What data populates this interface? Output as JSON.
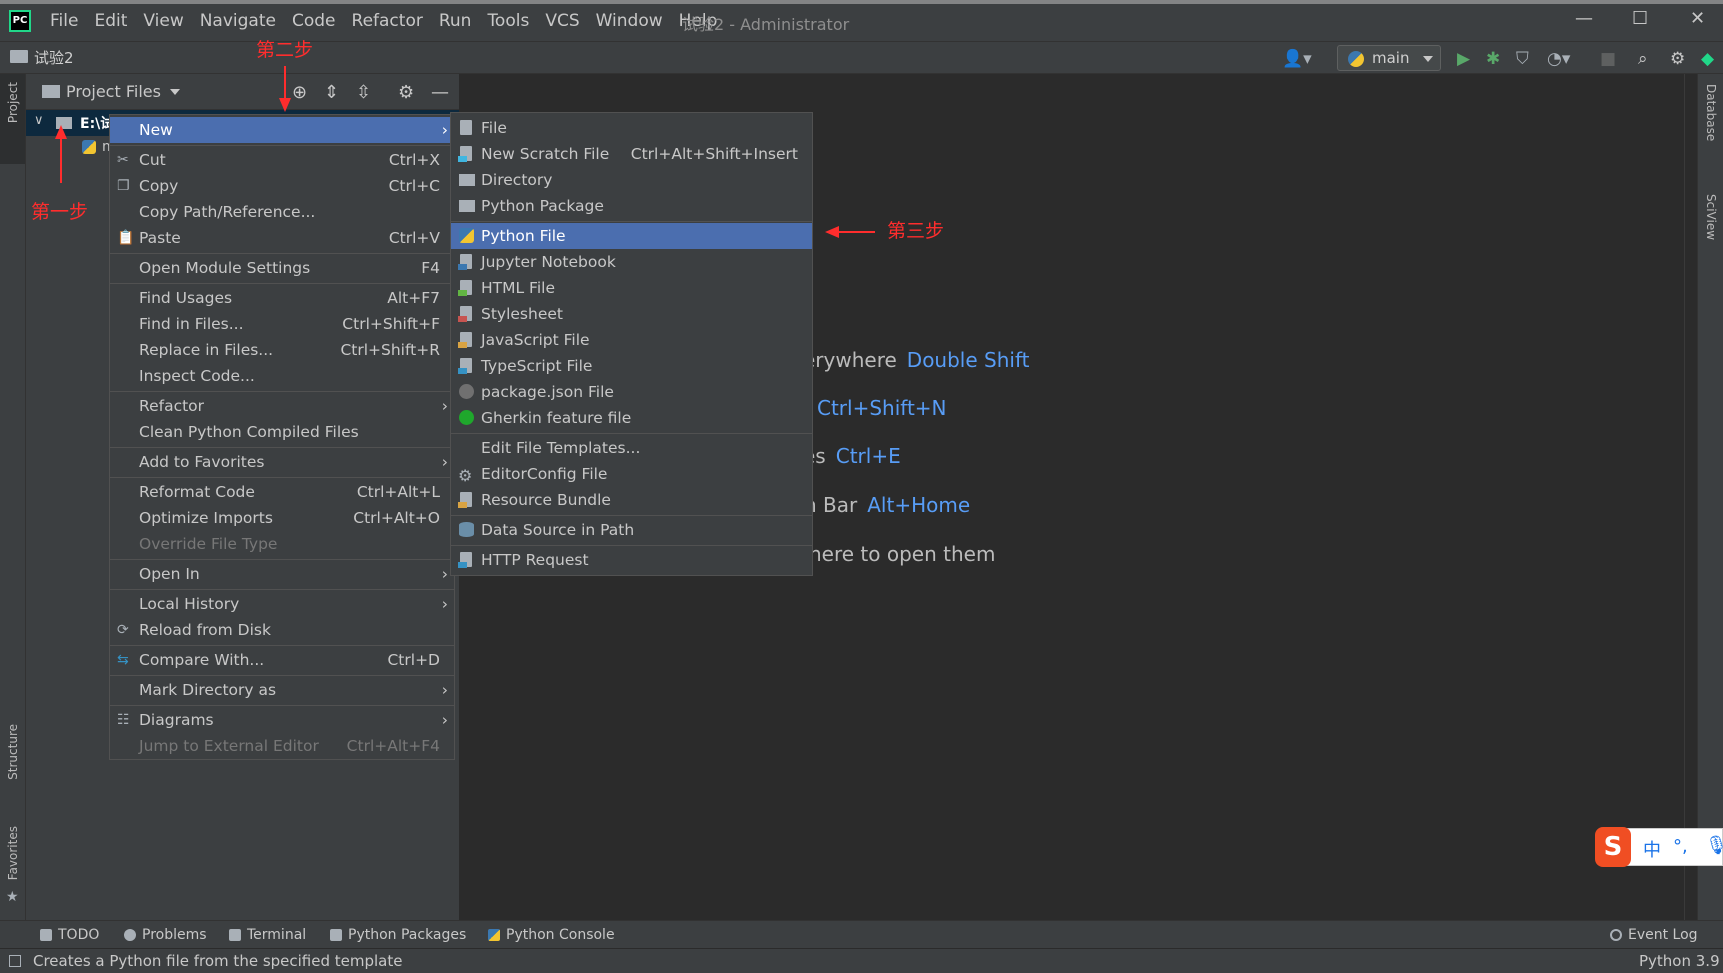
{
  "menubar": [
    "File",
    "Edit",
    "View",
    "Navigate",
    "Code",
    "Refactor",
    "Run",
    "Tools",
    "VCS",
    "Window",
    "Help"
  ],
  "window_title": "试验2 - Administrator",
  "window_controls": {
    "minimize": "—",
    "maximize": "☐",
    "close": "✕"
  },
  "logo": "PC",
  "breadcrumb": "试验2",
  "run_config": "main",
  "left_strip": {
    "top": "Project",
    "structure": "Structure",
    "favorites": "Favorites"
  },
  "right_strip": {
    "database": "Database",
    "sciview": "SciView"
  },
  "project_panel": {
    "title": "Project Files",
    "tree_root": "E:\\试",
    "tree_child": "m"
  },
  "editor_hints": [
    {
      "text": "erywhere",
      "key": "Double Shift"
    },
    {
      "text": "",
      "key": "Ctrl+Shift+N"
    },
    {
      "text": "es",
      "key": "Ctrl+E"
    },
    {
      "text": "n Bar",
      "key": "Alt+Home"
    },
    {
      "text": "here to open them",
      "key": ""
    }
  ],
  "context_menu": [
    {
      "label": "New",
      "shortcut": "",
      "submenu": true,
      "selected": true
    },
    {
      "label": "Cut",
      "shortcut": "Ctrl+X",
      "icon": "scissors-icon"
    },
    {
      "label": "Copy",
      "shortcut": "Ctrl+C",
      "icon": "copy-icon"
    },
    {
      "label": "Copy Path/Reference...",
      "shortcut": ""
    },
    {
      "label": "Paste",
      "shortcut": "Ctrl+V",
      "icon": "paste-icon"
    },
    {
      "label": "Open Module Settings",
      "shortcut": "F4"
    },
    {
      "label": "Find Usages",
      "shortcut": "Alt+F7"
    },
    {
      "label": "Find in Files...",
      "shortcut": "Ctrl+Shift+F"
    },
    {
      "label": "Replace in Files...",
      "shortcut": "Ctrl+Shift+R"
    },
    {
      "label": "Inspect Code...",
      "shortcut": ""
    },
    {
      "label": "Refactor",
      "shortcut": "",
      "submenu": true
    },
    {
      "label": "Clean Python Compiled Files",
      "shortcut": ""
    },
    {
      "label": "Add to Favorites",
      "shortcut": "",
      "submenu": true
    },
    {
      "label": "Reformat Code",
      "shortcut": "Ctrl+Alt+L"
    },
    {
      "label": "Optimize Imports",
      "shortcut": "Ctrl+Alt+O"
    },
    {
      "label": "Override File Type",
      "shortcut": "",
      "disabled": true
    },
    {
      "label": "Open In",
      "shortcut": "",
      "submenu": true
    },
    {
      "label": "Local History",
      "shortcut": "",
      "submenu": true
    },
    {
      "label": "Reload from Disk",
      "shortcut": "",
      "icon": "reload-icon"
    },
    {
      "label": "Compare With...",
      "shortcut": "Ctrl+D",
      "icon": "compare-icon"
    },
    {
      "label": "Mark Directory as",
      "shortcut": "",
      "submenu": true
    },
    {
      "label": "Diagrams",
      "shortcut": "",
      "submenu": true,
      "icon": "diagram-icon"
    },
    {
      "label": "Jump to External Editor",
      "shortcut": "Ctrl+Alt+F4",
      "disabled": true
    }
  ],
  "submenu": [
    {
      "label": "File",
      "shortcut": ""
    },
    {
      "label": "New Scratch File",
      "shortcut": "Ctrl+Alt+Shift+Insert"
    },
    {
      "label": "Directory",
      "shortcut": ""
    },
    {
      "label": "Python Package",
      "shortcut": ""
    },
    {
      "label": "Python File",
      "shortcut": "",
      "selected": true
    },
    {
      "label": "Jupyter Notebook",
      "shortcut": ""
    },
    {
      "label": "HTML File",
      "shortcut": ""
    },
    {
      "label": "Stylesheet",
      "shortcut": ""
    },
    {
      "label": "JavaScript File",
      "shortcut": ""
    },
    {
      "label": "TypeScript File",
      "shortcut": ""
    },
    {
      "label": "package.json File",
      "shortcut": ""
    },
    {
      "label": "Gherkin feature file",
      "shortcut": ""
    },
    {
      "label": "Edit File Templates...",
      "shortcut": ""
    },
    {
      "label": "EditorConfig File",
      "shortcut": ""
    },
    {
      "label": "Resource Bundle",
      "shortcut": ""
    },
    {
      "label": "Data Source in Path",
      "shortcut": ""
    },
    {
      "label": "HTTP Request",
      "shortcut": ""
    }
  ],
  "annotations": {
    "step1": "第一步",
    "step2": "第二步",
    "step3": "第三步"
  },
  "bottom_tools": [
    "TODO",
    "Problems",
    "Terminal",
    "Python Packages",
    "Python Console"
  ],
  "event_log": "Event Log",
  "status_text": "Creates a Python file from the specified template",
  "interpreter": "Python 3.9",
  "ime": {
    "lang": "中",
    "punct": "°,"
  },
  "colors": {
    "selection": "#4b6eaf",
    "link": "#589df6",
    "annotation": "#ff2d2d"
  }
}
